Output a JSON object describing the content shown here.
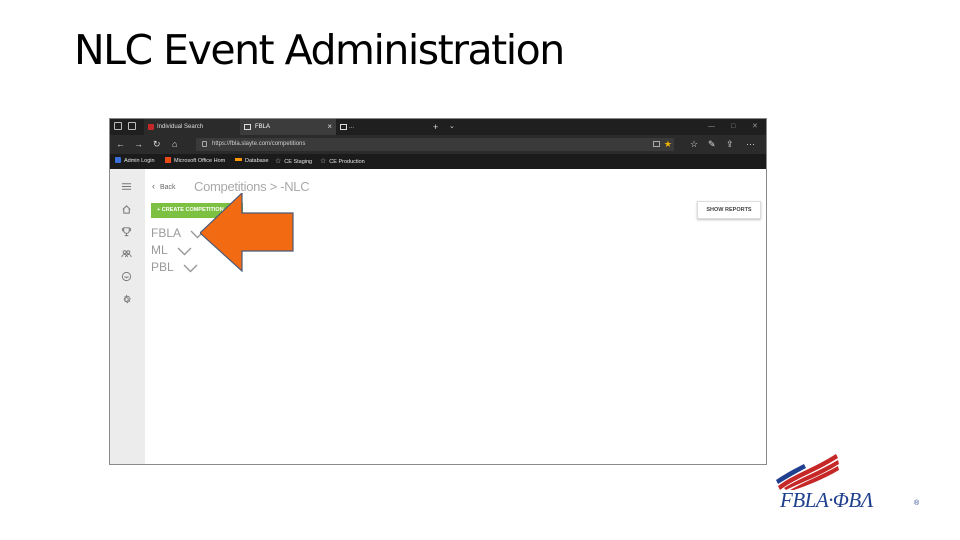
{
  "slide": {
    "title": "NLC Event Administration"
  },
  "browser": {
    "tabs": [
      {
        "label": "Individual Search",
        "active": false
      },
      {
        "label": "FBLA",
        "active": true
      },
      {
        "label": "...",
        "active": false
      }
    ],
    "new_tab_glyph": "+",
    "address": "https://fbla.slayte.com/competitions",
    "favorites": [
      {
        "label": "Admin Login",
        "icon": "admin-icon"
      },
      {
        "label": "Microsoft Office Hom",
        "icon": "office-icon"
      },
      {
        "label": "Database",
        "icon": "database-icon"
      },
      {
        "label": "CE Staging",
        "icon": "star-icon"
      },
      {
        "label": "CE Production",
        "icon": "star-icon"
      }
    ]
  },
  "app": {
    "back_label": "Back",
    "breadcrumb": "Competitions > -NLC",
    "create_button": "+ CREATE COMPETITION",
    "report_button": "SHOW REPORTS",
    "groups": [
      "FBLA",
      "ML",
      "PBL"
    ],
    "sidebar_icons": [
      "menu-icon",
      "home-icon",
      "trophy-icon",
      "group-icon",
      "inbox-icon",
      "settings-icon"
    ]
  },
  "logo": {
    "text": "FBLA·ΦΒΛ",
    "registered": "®"
  },
  "colors": {
    "accent_green": "#7cc142",
    "arrow_orange": "#f26b12",
    "logo_blue": "#1f3f8f",
    "logo_red": "#c62828"
  }
}
